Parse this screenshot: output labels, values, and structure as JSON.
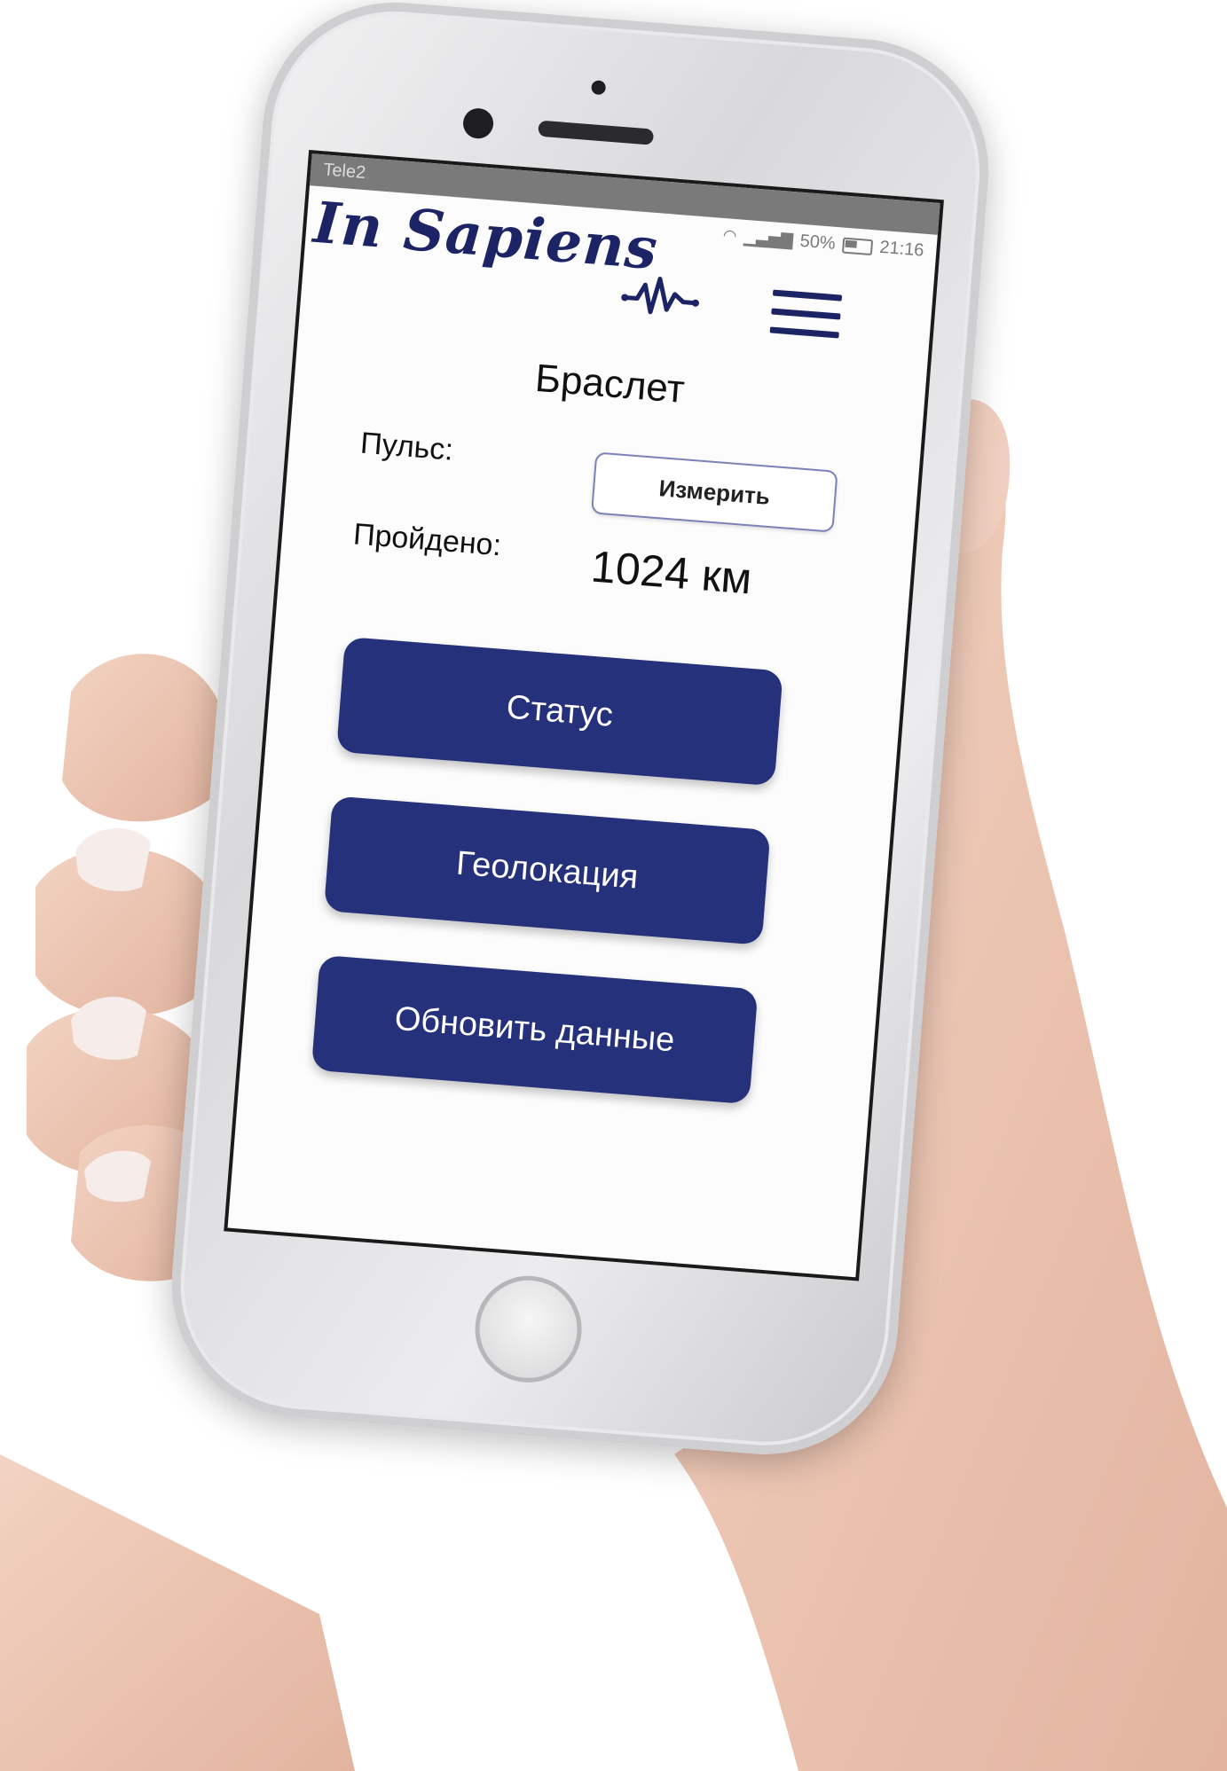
{
  "status_bar": {
    "carrier": "Tele2",
    "battery": "50%",
    "time": "21:16"
  },
  "header": {
    "logo_text": "In Sapiens",
    "pulse_icon": "heartbeat-icon",
    "menu_icon": "hamburger-menu-icon"
  },
  "main": {
    "title": "Браслет",
    "pulse_label": "Пульс:",
    "measure_button": "Измерить",
    "walked_label": "Пройдено:",
    "walked_value": "1024 км"
  },
  "actions": {
    "status_button": "Статус",
    "geo_button": "Геолокация",
    "update_button": "Обновить данные"
  },
  "colors": {
    "brand": "#1c2466",
    "button_fill": "#25317a",
    "button_text": "#ffffff"
  }
}
